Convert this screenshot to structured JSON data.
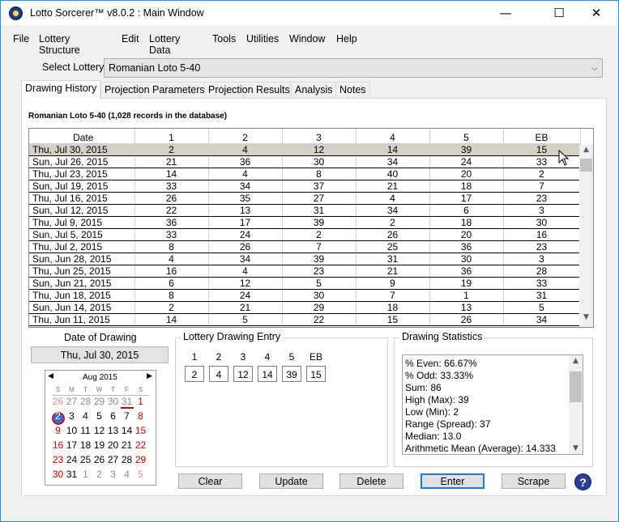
{
  "window": {
    "title": "Lotto Sorcerer™ v8.0.2 : Main Window",
    "minimize": "—",
    "maximize": "☐",
    "close": "✕"
  },
  "menu": [
    "File",
    "Lottery Structure",
    "Edit",
    "Lottery Data",
    "Tools",
    "Utilities",
    "Window",
    "Help"
  ],
  "select_lottery": {
    "label": "Select Lottery:",
    "value": "Romanian Loto 5-40"
  },
  "tabs": [
    "Drawing History",
    "Projection Parameters",
    "Projection Results",
    "Analysis",
    "Notes"
  ],
  "active_tab": "Drawing History",
  "records_label": "Romanian Loto 5-40 (1,028 records in the database)",
  "history": {
    "columns": [
      "Date",
      "1",
      "2",
      "3",
      "4",
      "5",
      "EB"
    ],
    "rows": [
      [
        "Thu, Jul 30, 2015",
        "2",
        "4",
        "12",
        "14",
        "39",
        "15"
      ],
      [
        "Sun, Jul 26, 2015",
        "21",
        "36",
        "30",
        "34",
        "24",
        "33"
      ],
      [
        "Thu, Jul 23, 2015",
        "14",
        "4",
        "8",
        "40",
        "20",
        "2"
      ],
      [
        "Sun, Jul 19, 2015",
        "33",
        "34",
        "37",
        "21",
        "18",
        "7"
      ],
      [
        "Thu, Jul 16, 2015",
        "26",
        "35",
        "27",
        "4",
        "17",
        "23"
      ],
      [
        "Sun, Jul 12, 2015",
        "22",
        "13",
        "31",
        "34",
        "6",
        "3"
      ],
      [
        "Thu, Jul 9, 2015",
        "36",
        "17",
        "39",
        "2",
        "18",
        "30"
      ],
      [
        "Sun, Jul 5, 2015",
        "33",
        "24",
        "2",
        "26",
        "20",
        "16"
      ],
      [
        "Thu, Jul 2, 2015",
        "8",
        "26",
        "7",
        "25",
        "36",
        "23"
      ],
      [
        "Sun, Jun 28, 2015",
        "4",
        "34",
        "39",
        "31",
        "30",
        "3"
      ],
      [
        "Thu, Jun 25, 2015",
        "16",
        "4",
        "23",
        "21",
        "36",
        "28"
      ],
      [
        "Sun, Jun 21, 2015",
        "6",
        "12",
        "5",
        "9",
        "19",
        "33"
      ],
      [
        "Thu, Jun 18, 2015",
        "8",
        "24",
        "30",
        "7",
        "1",
        "31"
      ],
      [
        "Sun, Jun 14, 2015",
        "2",
        "21",
        "29",
        "18",
        "13",
        "5"
      ],
      [
        "Thu, Jun 11, 2015",
        "14",
        "5",
        "22",
        "15",
        "26",
        "34"
      ]
    ],
    "selected_index": 0
  },
  "date_of_drawing": {
    "label": "Date of Drawing",
    "value": "Thu, Jul 30, 2015"
  },
  "calendar": {
    "month": "Aug 2015",
    "dow": [
      "S",
      "M",
      "T",
      "W",
      "T",
      "F",
      "S"
    ],
    "weeks": [
      [
        "26",
        "27",
        "28",
        "29",
        "30",
        "31",
        "1"
      ],
      [
        "2",
        "3",
        "4",
        "5",
        "6",
        "7",
        "8"
      ],
      [
        "9",
        "10",
        "11",
        "12",
        "13",
        "14",
        "15"
      ],
      [
        "16",
        "17",
        "18",
        "19",
        "20",
        "21",
        "22"
      ],
      [
        "23",
        "24",
        "25",
        "26",
        "27",
        "28",
        "29"
      ],
      [
        "30",
        "31",
        "1",
        "2",
        "3",
        "4",
        "5"
      ]
    ]
  },
  "entry": {
    "title": "Lottery Drawing Entry",
    "headers": [
      "1",
      "2",
      "3",
      "4",
      "5",
      "EB"
    ],
    "values": [
      "2",
      "4",
      "12",
      "14",
      "39",
      "15"
    ]
  },
  "stats": {
    "title": "Drawing Statistics",
    "lines": [
      "% Even: 66.67%",
      "% Odd: 33.33%",
      "Sum: 86",
      "High (Max): 39",
      "Low (Min): 2",
      "Range (Spread): 37",
      "Median: 13.0",
      "Arithmetic Mean (Average): 14.333"
    ]
  },
  "buttons": {
    "clear": "Clear",
    "update": "Update",
    "delete": "Delete",
    "enter": "Enter",
    "scrape": "Scrape",
    "help": "?"
  },
  "colors": {
    "selected_row": "#d4d0c8",
    "window_border": "#1b8fd9",
    "weekend_red": "#cc0000"
  }
}
